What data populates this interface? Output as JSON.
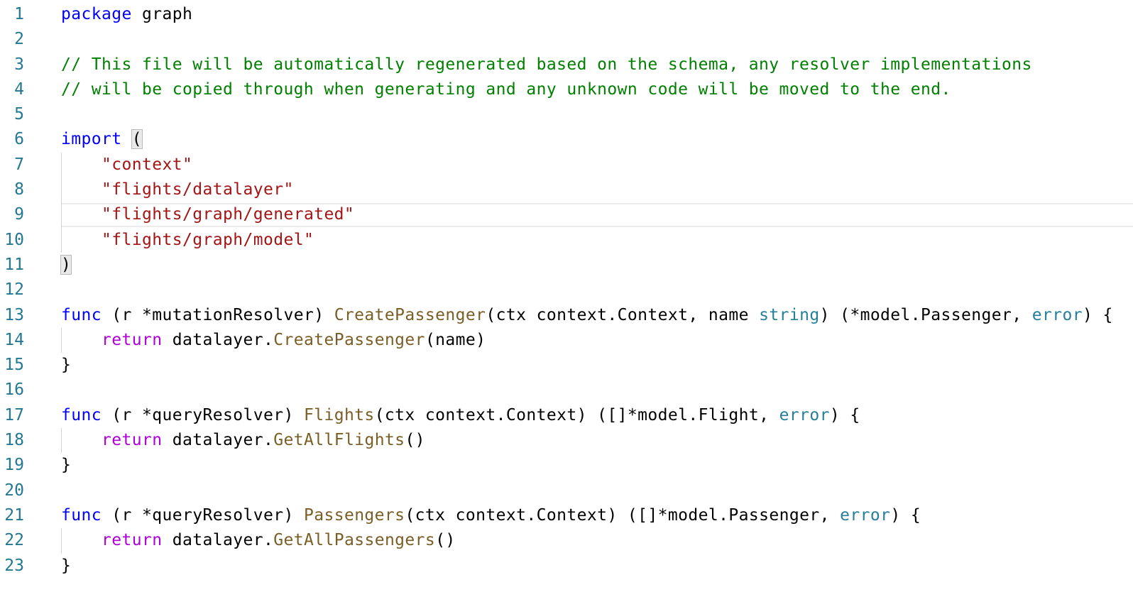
{
  "editor": {
    "language": "go",
    "current_line": 9,
    "colors": {
      "line_number": "#237893",
      "keyword": "#0000ff",
      "control_keyword": "#af00db",
      "comment": "#008000",
      "string": "#a31515",
      "function": "#795e26",
      "type": "#267f99",
      "plain": "#000000"
    },
    "lines": [
      {
        "number": "1",
        "indent": 0,
        "tokens": [
          {
            "t": "keyword",
            "v": "package"
          },
          {
            "t": "plain",
            "v": " graph"
          }
        ]
      },
      {
        "number": "2",
        "indent": 0,
        "tokens": []
      },
      {
        "number": "3",
        "indent": 0,
        "tokens": [
          {
            "t": "comment",
            "v": "// This file will be automatically regenerated based on the schema, any resolver implementations"
          }
        ]
      },
      {
        "number": "4",
        "indent": 0,
        "tokens": [
          {
            "t": "comment",
            "v": "// will be copied through when generating and any unknown code will be moved to the end."
          }
        ]
      },
      {
        "number": "5",
        "indent": 0,
        "tokens": []
      },
      {
        "number": "6",
        "indent": 0,
        "tokens": [
          {
            "t": "keyword",
            "v": "import"
          },
          {
            "t": "plain",
            "v": " "
          },
          {
            "t": "bracket",
            "v": "("
          }
        ]
      },
      {
        "number": "7",
        "indent": 1,
        "tokens": [
          {
            "t": "string",
            "v": "\"context\""
          }
        ]
      },
      {
        "number": "8",
        "indent": 1,
        "tokens": [
          {
            "t": "string",
            "v": "\"flights/datalayer\""
          }
        ]
      },
      {
        "number": "9",
        "indent": 1,
        "tokens": [
          {
            "t": "string",
            "v": "\"flights/graph/generated\""
          }
        ]
      },
      {
        "number": "10",
        "indent": 1,
        "tokens": [
          {
            "t": "string",
            "v": "\"flights/graph/model\""
          }
        ]
      },
      {
        "number": "11",
        "indent": 0,
        "tokens": [
          {
            "t": "bracket",
            "v": ")"
          }
        ]
      },
      {
        "number": "12",
        "indent": 0,
        "tokens": []
      },
      {
        "number": "13",
        "indent": 0,
        "tokens": [
          {
            "t": "keyword",
            "v": "func"
          },
          {
            "t": "plain",
            "v": " (r *mutationResolver) "
          },
          {
            "t": "function",
            "v": "CreatePassenger"
          },
          {
            "t": "plain",
            "v": "(ctx context.Context, name "
          },
          {
            "t": "type",
            "v": "string"
          },
          {
            "t": "plain",
            "v": ") (*model.Passenger, "
          },
          {
            "t": "type",
            "v": "error"
          },
          {
            "t": "plain",
            "v": ") {"
          }
        ]
      },
      {
        "number": "14",
        "indent": 1,
        "tokens": [
          {
            "t": "control",
            "v": "return"
          },
          {
            "t": "plain",
            "v": " datalayer."
          },
          {
            "t": "function",
            "v": "CreatePassenger"
          },
          {
            "t": "plain",
            "v": "(name)"
          }
        ]
      },
      {
        "number": "15",
        "indent": 0,
        "tokens": [
          {
            "t": "plain",
            "v": "}"
          }
        ]
      },
      {
        "number": "16",
        "indent": 0,
        "tokens": []
      },
      {
        "number": "17",
        "indent": 0,
        "tokens": [
          {
            "t": "keyword",
            "v": "func"
          },
          {
            "t": "plain",
            "v": " (r *queryResolver) "
          },
          {
            "t": "function",
            "v": "Flights"
          },
          {
            "t": "plain",
            "v": "(ctx context.Context) ([]*model.Flight, "
          },
          {
            "t": "type",
            "v": "error"
          },
          {
            "t": "plain",
            "v": ") {"
          }
        ]
      },
      {
        "number": "18",
        "indent": 1,
        "tokens": [
          {
            "t": "control",
            "v": "return"
          },
          {
            "t": "plain",
            "v": " datalayer."
          },
          {
            "t": "function",
            "v": "GetAllFlights"
          },
          {
            "t": "plain",
            "v": "()"
          }
        ]
      },
      {
        "number": "19",
        "indent": 0,
        "tokens": [
          {
            "t": "plain",
            "v": "}"
          }
        ]
      },
      {
        "number": "20",
        "indent": 0,
        "tokens": []
      },
      {
        "number": "21",
        "indent": 0,
        "tokens": [
          {
            "t": "keyword",
            "v": "func"
          },
          {
            "t": "plain",
            "v": " (r *queryResolver) "
          },
          {
            "t": "function",
            "v": "Passengers"
          },
          {
            "t": "plain",
            "v": "(ctx context.Context) ([]*model.Passenger, "
          },
          {
            "t": "type",
            "v": "error"
          },
          {
            "t": "plain",
            "v": ") {"
          }
        ]
      },
      {
        "number": "22",
        "indent": 1,
        "tokens": [
          {
            "t": "control",
            "v": "return"
          },
          {
            "t": "plain",
            "v": " datalayer."
          },
          {
            "t": "function",
            "v": "GetAllPassengers"
          },
          {
            "t": "plain",
            "v": "()"
          }
        ]
      },
      {
        "number": "23",
        "indent": 0,
        "tokens": [
          {
            "t": "plain",
            "v": "}"
          }
        ]
      }
    ]
  }
}
